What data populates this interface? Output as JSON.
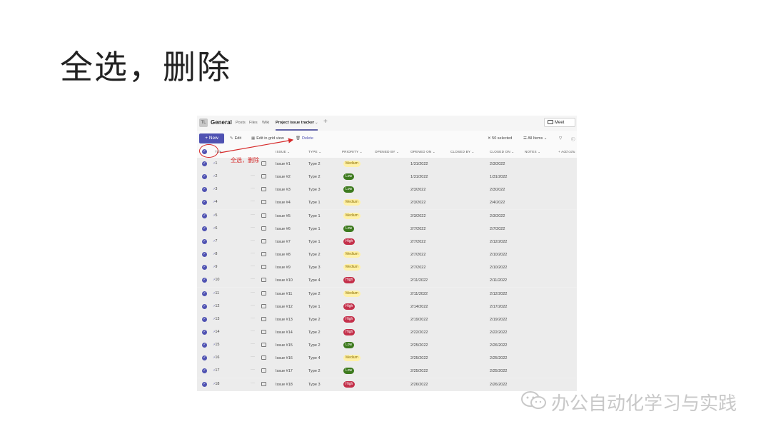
{
  "slide": {
    "title": "全选，删除"
  },
  "header": {
    "team_initials": "TL",
    "channel": "General",
    "tabs": [
      "Posts",
      "Files",
      "Wiki",
      "Project issue tracker"
    ],
    "active_tab_dropdown": "⌄",
    "add_tab": "+",
    "meet_label": "Meet"
  },
  "toolbar": {
    "new_label": "New",
    "edit_label": "Edit",
    "grid_label": "Edit in grid view",
    "delete_label": "Delete",
    "selected_label": "50 selected",
    "view_label": "All Items"
  },
  "columns": {
    "title": "Title",
    "issue": "ISSUE",
    "type": "TYPE",
    "priority": "PRIORITY",
    "opened_by": "OPENED BY",
    "opened_on": "OPENED ON",
    "closed_by": "CLOSED BY",
    "closed_on": "CLOSED ON",
    "notes": "NOTES",
    "add_column": "+ Add colu"
  },
  "rows": [
    {
      "id": "1",
      "issue": "Issue #1",
      "type": "Type 2",
      "priority": "Medium",
      "opened_on": "1/31/2022",
      "closed_on": "2/3/2022"
    },
    {
      "id": "2",
      "issue": "Issue #2",
      "type": "Type 2",
      "priority": "Low",
      "opened_on": "1/31/2022",
      "closed_on": "1/31/2022"
    },
    {
      "id": "3",
      "issue": "Issue #3",
      "type": "Type 3",
      "priority": "Low",
      "opened_on": "2/3/2022",
      "closed_on": "2/3/2022"
    },
    {
      "id": "4",
      "issue": "Issue #4",
      "type": "Type 1",
      "priority": "Medium",
      "opened_on": "2/3/2022",
      "closed_on": "2/4/2022"
    },
    {
      "id": "5",
      "issue": "Issue #5",
      "type": "Type 1",
      "priority": "Medium",
      "opened_on": "2/3/2022",
      "closed_on": "2/3/2022"
    },
    {
      "id": "6",
      "issue": "Issue #6",
      "type": "Type 1",
      "priority": "Low",
      "opened_on": "2/7/2022",
      "closed_on": "2/7/2022"
    },
    {
      "id": "7",
      "issue": "Issue #7",
      "type": "Type 1",
      "priority": "High",
      "opened_on": "2/7/2022",
      "closed_on": "2/12/2022"
    },
    {
      "id": "8",
      "issue": "Issue #8",
      "type": "Type 2",
      "priority": "Medium",
      "opened_on": "2/7/2022",
      "closed_on": "2/10/2022"
    },
    {
      "id": "9",
      "issue": "Issue #9",
      "type": "Type 3",
      "priority": "Medium",
      "opened_on": "2/7/2022",
      "closed_on": "2/10/2022"
    },
    {
      "id": "10",
      "issue": "Issue #10",
      "type": "Type 4",
      "priority": "High",
      "opened_on": "2/11/2022",
      "closed_on": "2/11/2022"
    },
    {
      "id": "11",
      "issue": "Issue #11",
      "type": "Type 2",
      "priority": "Medium",
      "opened_on": "2/11/2022",
      "closed_on": "2/12/2022"
    },
    {
      "id": "12",
      "issue": "Issue #12",
      "type": "Type 1",
      "priority": "High",
      "opened_on": "2/14/2022",
      "closed_on": "2/17/2022"
    },
    {
      "id": "13",
      "issue": "Issue #13",
      "type": "Type 2",
      "priority": "High",
      "opened_on": "2/19/2022",
      "closed_on": "2/19/2022"
    },
    {
      "id": "14",
      "issue": "Issue #14",
      "type": "Type 2",
      "priority": "High",
      "opened_on": "2/22/2022",
      "closed_on": "2/22/2022"
    },
    {
      "id": "15",
      "issue": "Issue #15",
      "type": "Type 2",
      "priority": "Low",
      "opened_on": "2/25/2022",
      "closed_on": "2/26/2022"
    },
    {
      "id": "16",
      "issue": "Issue #16",
      "type": "Type 4",
      "priority": "Medium",
      "opened_on": "2/25/2022",
      "closed_on": "2/25/2022"
    },
    {
      "id": "17",
      "issue": "Issue #17",
      "type": "Type 2",
      "priority": "Low",
      "opened_on": "2/25/2022",
      "closed_on": "2/25/2022"
    },
    {
      "id": "18",
      "issue": "Issue #18",
      "type": "Type 3",
      "priority": "High",
      "opened_on": "2/26/2022",
      "closed_on": "2/26/2022"
    }
  ],
  "annotation": {
    "text": "全选，删除",
    "color": "#d62a2a"
  },
  "watermark": {
    "text": "办公自动化学习与实践"
  },
  "colors": {
    "accent": "#4f52b2",
    "medium": "#fff1a8",
    "low": "#3d7a1e",
    "high": "#c4314b"
  }
}
